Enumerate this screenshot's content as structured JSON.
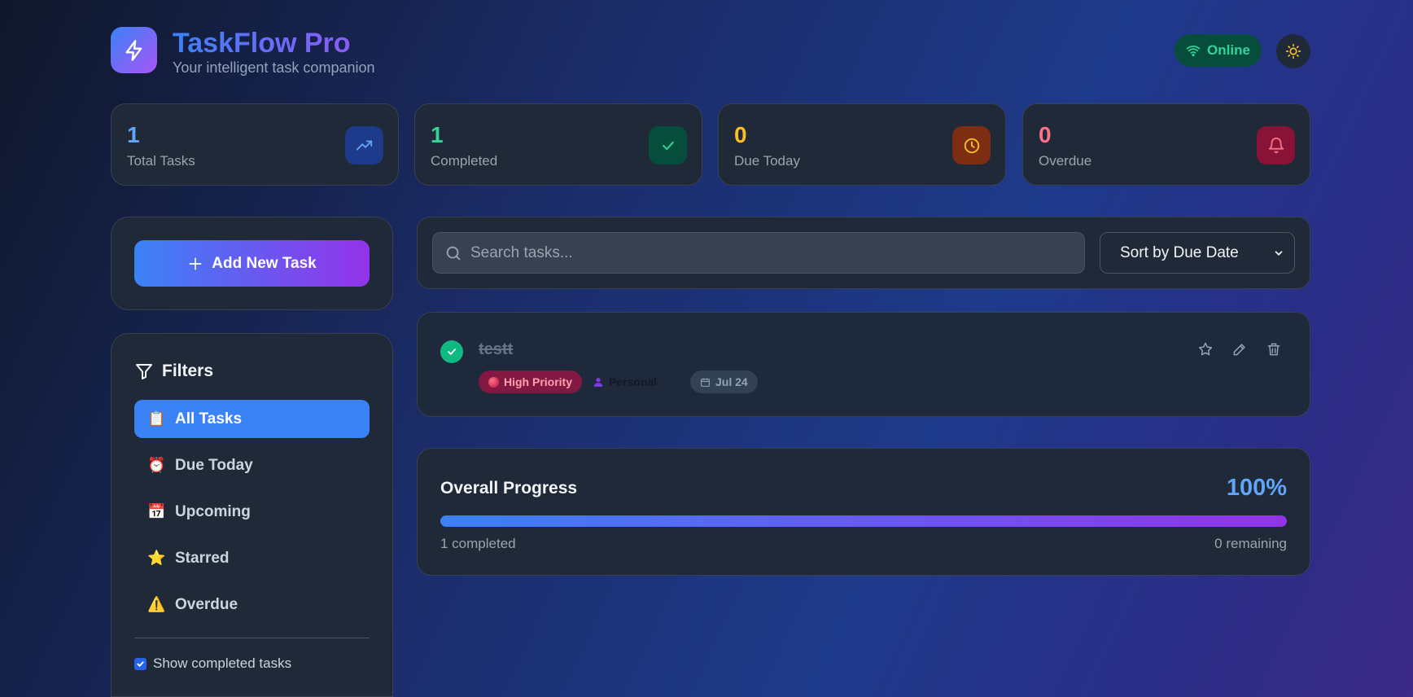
{
  "header": {
    "title": "TaskFlow Pro",
    "subtitle": "Your intelligent task companion",
    "status": "Online"
  },
  "stats": [
    {
      "value": "1",
      "label": "Total Tasks",
      "color": "#60a5fa",
      "icon": "trending-up-icon"
    },
    {
      "value": "1",
      "label": "Completed",
      "color": "#34d399",
      "icon": "check-icon"
    },
    {
      "value": "0",
      "label": "Due Today",
      "color": "#fbbf24",
      "icon": "clock-icon"
    },
    {
      "value": "0",
      "label": "Overdue",
      "color": "#fb7185",
      "icon": "bell-icon"
    }
  ],
  "sidebar": {
    "add_button": "Add New Task",
    "filters_title": "Filters",
    "items": [
      {
        "label": "All Tasks",
        "emoji": "📋",
        "active": true
      },
      {
        "label": "Due Today",
        "emoji": "⏰",
        "active": false
      },
      {
        "label": "Upcoming",
        "emoji": "📅",
        "active": false
      },
      {
        "label": "Starred",
        "emoji": "⭐",
        "active": false
      },
      {
        "label": "Overdue",
        "emoji": "⚠️",
        "active": false
      }
    ],
    "show_completed_label": "Show completed tasks",
    "show_completed_checked": true
  },
  "search": {
    "placeholder": "Search tasks...",
    "sort_selected": "Sort by Due Date"
  },
  "task": {
    "title": "testt",
    "completed": true,
    "priority": "High Priority",
    "category": "Personal",
    "due": "Jul 24"
  },
  "progress": {
    "title": "Overall Progress",
    "percent_label": "100%",
    "percent": 100,
    "completed_text": "1 completed",
    "remaining_text": "0 remaining"
  }
}
